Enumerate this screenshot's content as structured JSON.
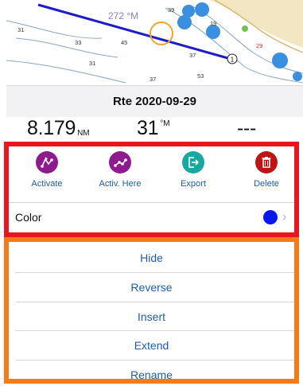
{
  "map": {
    "depth_labels": [
      "31",
      "33",
      "45",
      "31",
      "37",
      "53",
      "37",
      "39",
      "19",
      "29"
    ],
    "route_label": "272 °M",
    "waypoint_label": "1"
  },
  "route": {
    "title": "Rte 2020-09-29"
  },
  "stats": [
    {
      "value": "8.179",
      "unit": "NM"
    },
    {
      "value": "31",
      "unit": "°M"
    },
    {
      "value": "---",
      "unit": ""
    }
  ],
  "actions": [
    {
      "label": "Activate",
      "icon": "route-activate-icon",
      "color": "#8e1a8e"
    },
    {
      "label": "Activ. Here",
      "icon": "route-activate-here-icon",
      "color": "#8e1a8e"
    },
    {
      "label": "Export",
      "icon": "export-icon",
      "color": "#17a8a0"
    },
    {
      "label": "Delete",
      "icon": "trash-icon",
      "color": "#c01414"
    }
  ],
  "color_setting": {
    "label": "Color",
    "value_color": "#0a16f0",
    "chevron": "›"
  },
  "menu": {
    "items": [
      "Hide",
      "Reverse",
      "Insert",
      "Extend",
      "Rename"
    ]
  }
}
